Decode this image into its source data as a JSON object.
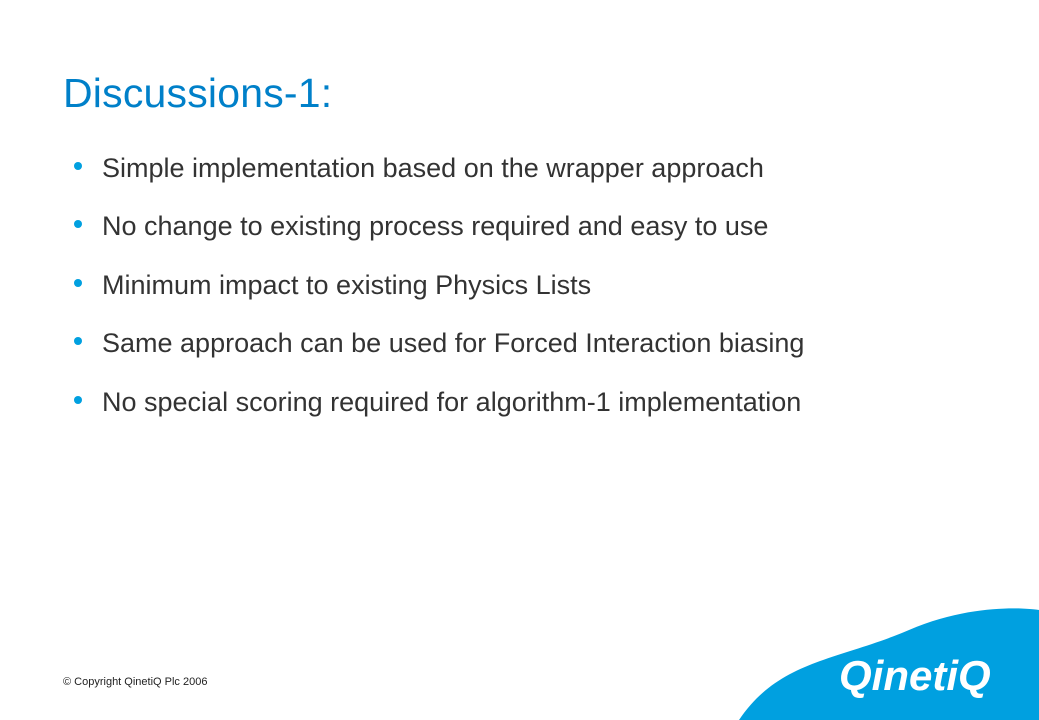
{
  "slide": {
    "title": "Discussions-1:",
    "bullets": [
      "Simple implementation based on the wrapper approach",
      "No change to existing process required and easy to use",
      "Minimum impact to existing Physics Lists",
      "Same approach can be used for Forced Interaction biasing",
      "No special scoring required for algorithm-1 implementation"
    ],
    "copyright": "© Copyright QinetiQ Plc 2006",
    "logo_text": "QinetiQ"
  },
  "colors": {
    "title": "#0080c9",
    "bullet": "#00a0e0",
    "logo_bg": "#00a0e0",
    "logo_text": "#ffffff"
  }
}
